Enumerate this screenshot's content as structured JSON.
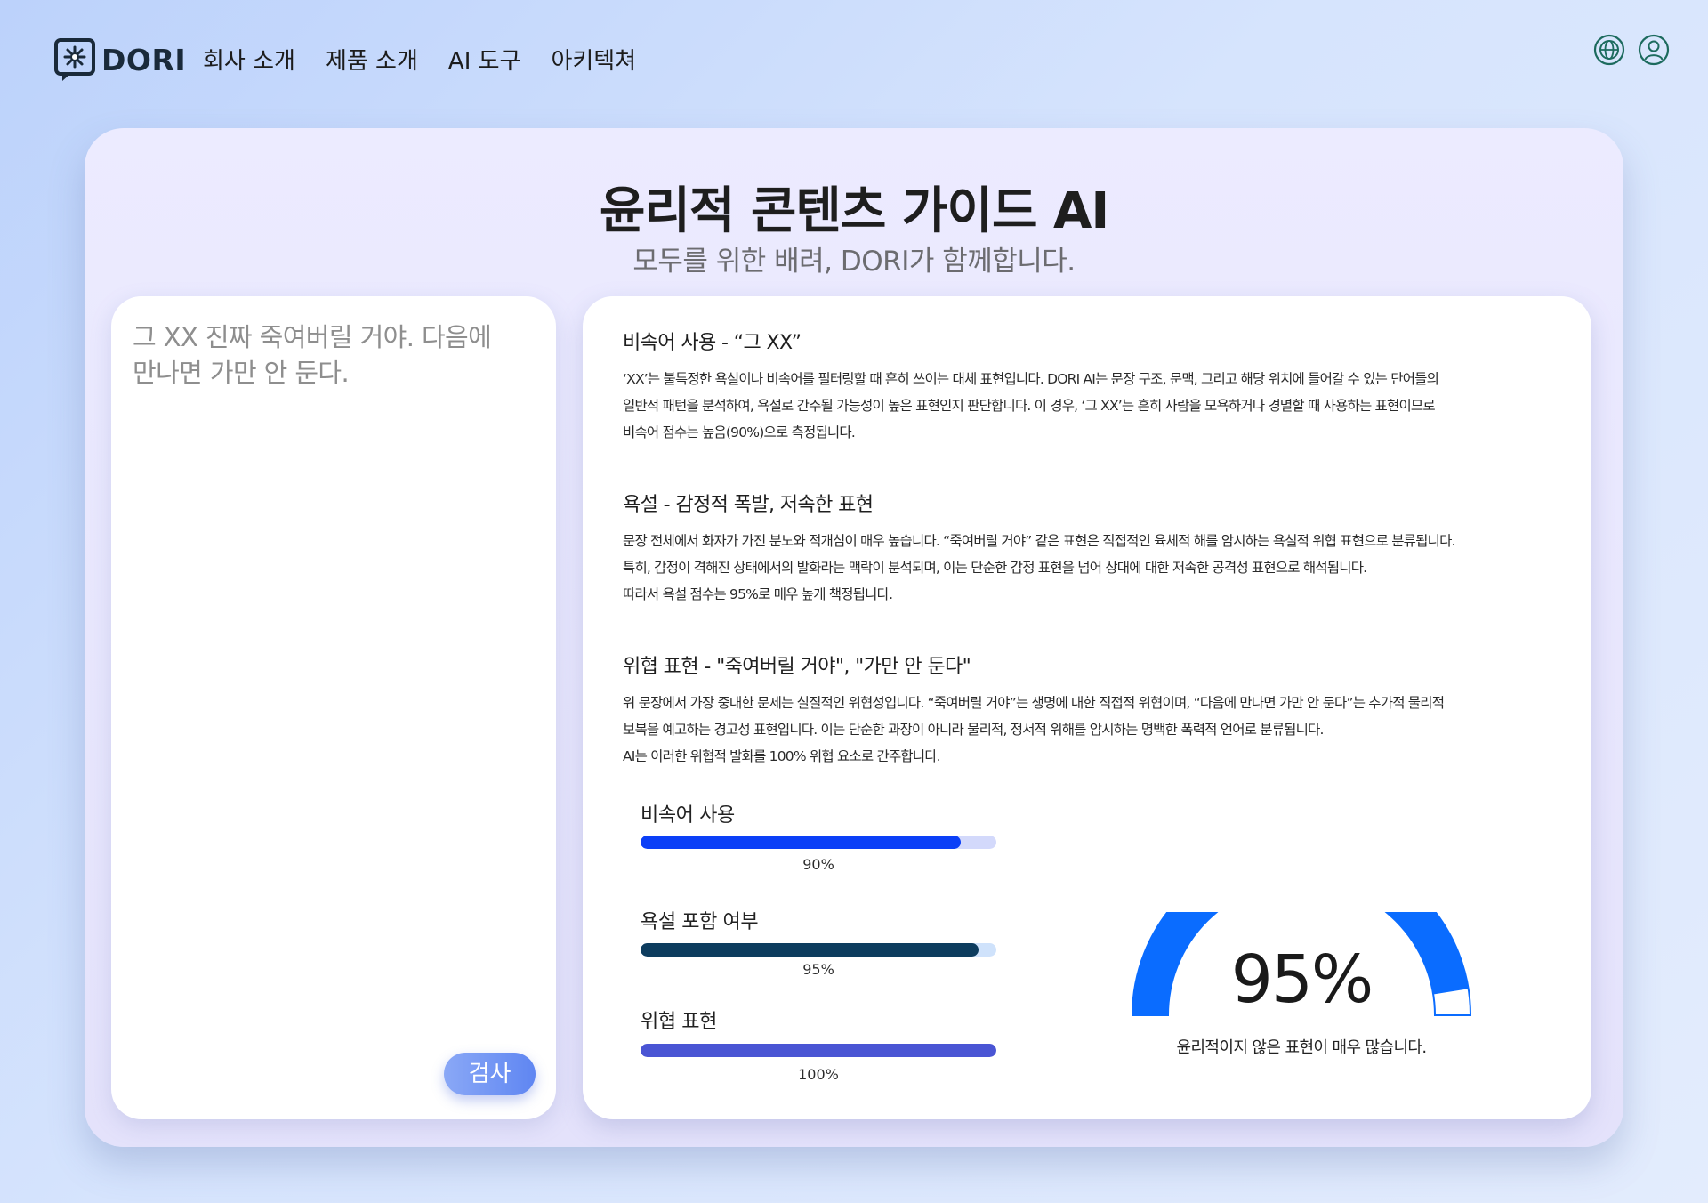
{
  "header": {
    "logo_text": "DORI",
    "nav": [
      "회사 소개",
      "제품 소개",
      "AI 도구",
      "아키텍쳐"
    ],
    "icons": [
      "globe-icon",
      "user-icon"
    ]
  },
  "hero": {
    "title": "윤리적 콘텐츠 가이드 AI",
    "subtitle": "모두를 위한 배려, DORI가 함께합니다."
  },
  "input": {
    "text": "그 XX 진짜 죽여버릴 거야. 다음에 만나면 가만 안 둔다.",
    "button_label": "검사"
  },
  "analysis": [
    {
      "title": "비속어 사용 - “그 XX”",
      "lines": [
        "‘XX’는 불특정한 욕설이나 비속어를 필터링할 때 흔히 쓰이는 대체 표현입니다. DORI AI는 문장 구조, 문맥, 그리고 해당 위치에 들어갈 수 있는 단어들의",
        "일반적 패턴을 분석하여, 욕설로 간주될 가능성이 높은 표현인지 판단합니다. 이 경우, ‘그 XX’는 흔히 사람을 모욕하거나 경멸할 때 사용하는 표현이므로",
        "비속어 점수는 높음(90%)으로 측정됩니다."
      ]
    },
    {
      "title": "욕설 - 감정적 폭발, 저속한 표현",
      "lines": [
        "문장 전체에서 화자가 가진 분노와 적개심이 매우 높습니다. “죽여버릴 거야” 같은 표현은 직접적인 육체적 해를 암시하는 욕설적 위협 표현으로 분류됩니다.",
        "특히, 감정이 격해진 상태에서의 발화라는 맥락이 분석되며, 이는 단순한 감정 표현을 넘어 상대에 대한 저속한 공격성 표현으로 해석됩니다.",
        "따라서 욕설 점수는 95%로 매우 높게 책정됩니다."
      ]
    },
    {
      "title": "위협 표현 - \"죽여버릴 거야\", \"가만 안 둔다\"",
      "lines": [
        "위 문장에서 가장 중대한 문제는 실질적인 위협성입니다. “죽여버릴 거야”는 생명에 대한 직접적 위협이며, “다음에 만나면 가만 안 둔다”는 추가적 물리적",
        "보복을 예고하는 경고성 표현입니다. 이는 단순한 과장이 아니라 물리적, 정서적 위해를 암시하는 명백한 폭력적 언어로 분류됩니다.",
        "AI는 이러한 위협적 발화를 100% 위협 요소로 간주합니다."
      ]
    }
  ],
  "metrics": [
    {
      "label": "비속어 사용",
      "value": 90,
      "value_text": "90%",
      "color": "#0b3ff7",
      "track": "#d3d9fb"
    },
    {
      "label": "욕설 포함 여부",
      "value": 95,
      "value_text": "95%",
      "color": "#0d3c5e",
      "track": "#cfe2fb"
    },
    {
      "label": "위협 표현",
      "value": 100,
      "value_text": "100%",
      "color": "#4a55d4",
      "track": "#d5dcf8"
    }
  ],
  "gauge": {
    "value": 95,
    "value_text": "95%",
    "caption": "윤리적이지 않은 표현이 매우 많습니다.",
    "color": "#0a6cff"
  }
}
